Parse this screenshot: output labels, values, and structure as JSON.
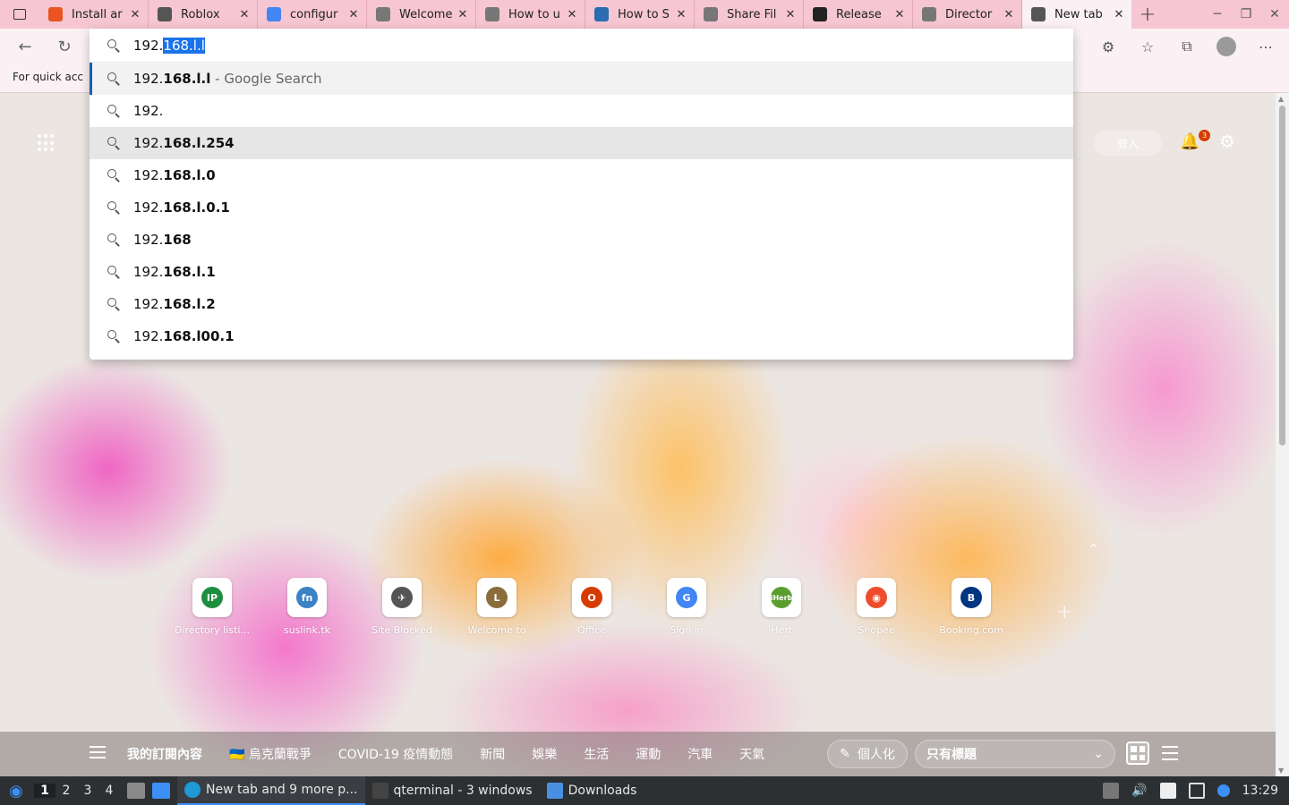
{
  "tabs": [
    {
      "label": "Install ar",
      "icon": "ubuntu-icon",
      "color": "#e95420"
    },
    {
      "label": "Roblox",
      "icon": "roblox-icon",
      "color": "#555555"
    },
    {
      "label": "configur",
      "icon": "google-icon",
      "color": "#4285f4"
    },
    {
      "label": "Welcome",
      "icon": "page-icon",
      "color": "#777777"
    },
    {
      "label": "How to u",
      "icon": "share-icon",
      "color": "#777777"
    },
    {
      "label": "How to S",
      "icon": "site-icon",
      "color": "#2b6cb0"
    },
    {
      "label": "Share Fil",
      "icon": "share-icon",
      "color": "#777777"
    },
    {
      "label": "Release",
      "icon": "github-icon",
      "color": "#222222"
    },
    {
      "label": "Director",
      "icon": "page-icon",
      "color": "#777777"
    },
    {
      "label": "New tab",
      "icon": "newtab-icon",
      "color": "#555555"
    }
  ],
  "favbar": {
    "hint": "For quick acc"
  },
  "omnibox": {
    "typed_prefix": "192.",
    "typed_selected": "168.l.l",
    "suggestions": [
      {
        "plain": "192.",
        "bold": "168.l.l",
        "suffix": " - Google Search"
      },
      {
        "plain": "192.",
        "bold": "",
        "suffix": ""
      },
      {
        "plain": "192.",
        "bold": "168.l.254",
        "suffix": ""
      },
      {
        "plain": "192.",
        "bold": "168.l.0",
        "suffix": ""
      },
      {
        "plain": "192.",
        "bold": "168.l.0.1",
        "suffix": ""
      },
      {
        "plain": "192.",
        "bold": "168",
        "suffix": ""
      },
      {
        "plain": "192.",
        "bold": "168.l.1",
        "suffix": ""
      },
      {
        "plain": "192.",
        "bold": "168.l.2",
        "suffix": ""
      },
      {
        "plain": "192.",
        "bold": "168.l00.1",
        "suffix": ""
      }
    ]
  },
  "header": {
    "signin": "登入",
    "notifications": "3"
  },
  "quicklinks": [
    {
      "name": "Directory listi...",
      "glyph": "IP",
      "color": "#1e8e3e"
    },
    {
      "name": "suslink.tk",
      "glyph": "fn",
      "color": "#3b82c4"
    },
    {
      "name": "Site Blocked",
      "glyph": "✈",
      "color": "#555555"
    },
    {
      "name": "Welcome to",
      "glyph": "L",
      "color": "#8a6d3b"
    },
    {
      "name": "Office",
      "glyph": "O",
      "color": "#d83b01"
    },
    {
      "name": "Sign in",
      "glyph": "G",
      "color": "#4285f4"
    },
    {
      "name": "iHerb",
      "glyph": "iHerb",
      "color": "#5a9e2f"
    },
    {
      "name": "Shopee",
      "glyph": "◉",
      "color": "#ee4d2d"
    },
    {
      "name": "Booking.com",
      "glyph": "B",
      "color": "#003580"
    }
  ],
  "newsbar": {
    "categories": [
      "我的訂閱內容",
      "🇺🇦 烏克蘭戰爭",
      "COVID-19 疫情動態",
      "新聞",
      "娛樂",
      "生活",
      "運動",
      "汽車",
      "天氣"
    ],
    "personalize": "個人化",
    "layout_value": "只有標題"
  },
  "taskbar": {
    "workspaces": [
      "1",
      "2",
      "3",
      "4"
    ],
    "tasks": [
      {
        "label": "New tab and 9 more p...",
        "icon": "edge-icon"
      },
      {
        "label": "qterminal - 3 windows",
        "icon": "terminal-icon"
      },
      {
        "label": "Downloads",
        "icon": "folder-icon"
      }
    ],
    "clock": "13:29"
  }
}
